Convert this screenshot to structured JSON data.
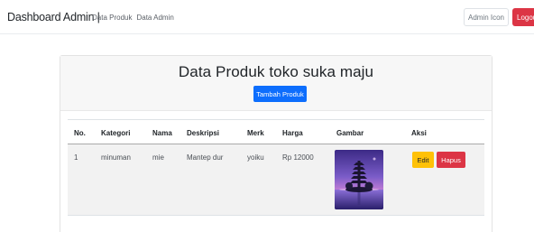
{
  "navbar": {
    "brand": "Dashboard Admin |",
    "links": [
      "Data Produk",
      "Data Admin"
    ],
    "admin_button": "Admin Icon",
    "logout_button": "Logout"
  },
  "card": {
    "title": "Data Produk toko suka maju",
    "add_button": "Tambah Produk"
  },
  "table": {
    "headers": [
      "No.",
      "Kategori",
      "Nama",
      "Deskripsi",
      "Merk",
      "Harga",
      "Gambar",
      "Aksi"
    ],
    "rows": [
      {
        "no": "1",
        "kategori": "minuman",
        "nama": "mie",
        "deskripsi": "Mantep dur",
        "merk": "yoiku",
        "harga": "Rp 12000",
        "gambar": "temple-photo",
        "edit": "Edit",
        "hapus": "Hapus"
      }
    ]
  },
  "colors": {
    "primary": "#0d6efd",
    "danger": "#dc3545",
    "warning": "#ffc107"
  }
}
